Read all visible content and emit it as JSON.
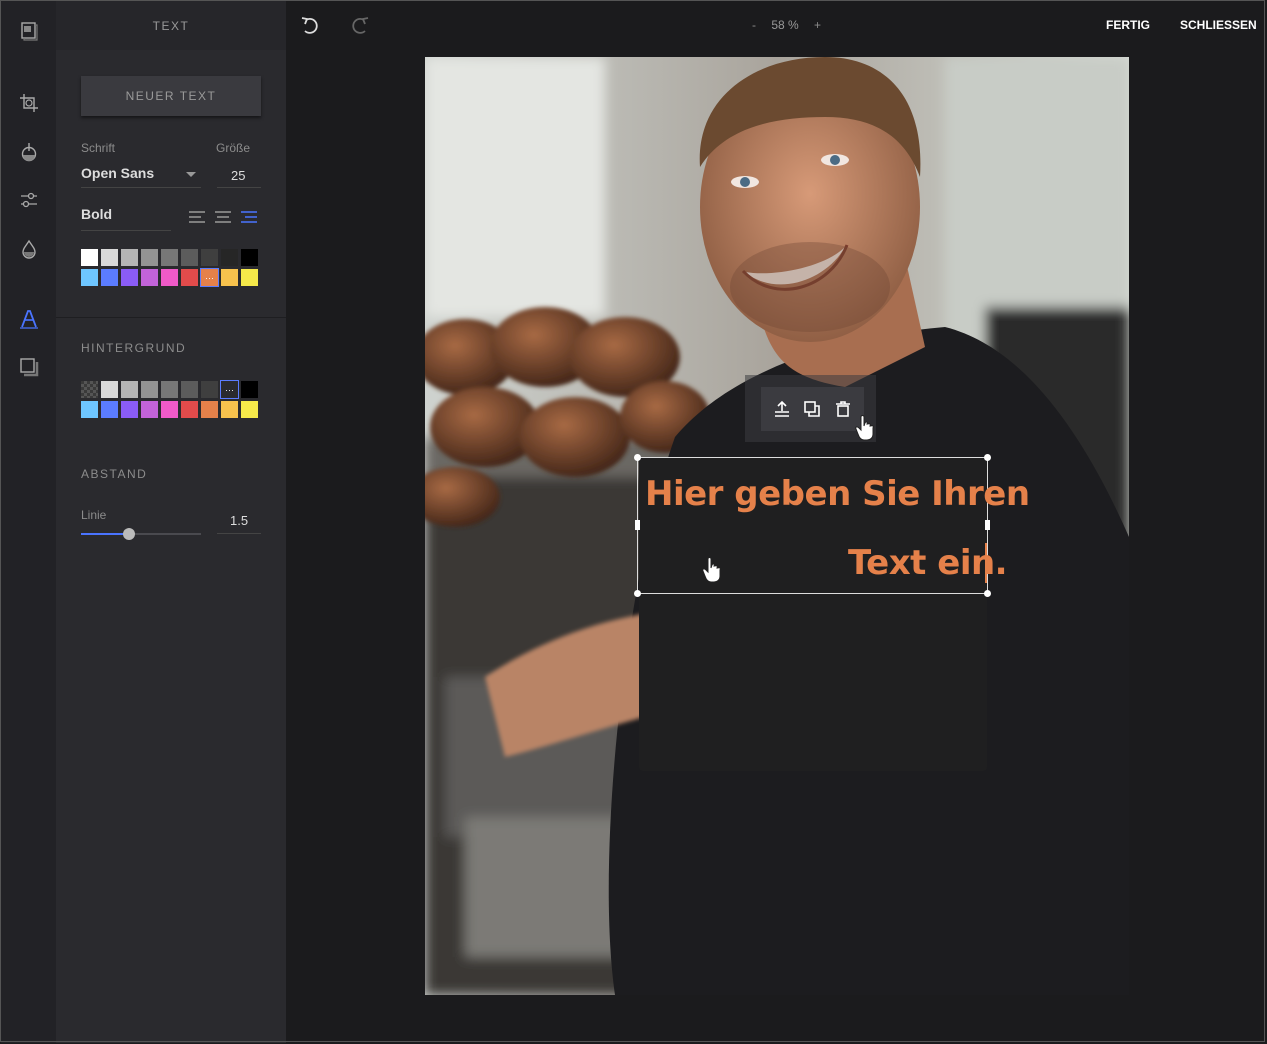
{
  "panel": {
    "title": "TEXT",
    "new_text_label": "NEUER TEXT",
    "font_label": "Schrift",
    "font_value": "Open Sans",
    "size_label": "Größe",
    "size_value": "25",
    "style_value": "Bold",
    "text_colors": [
      "#ffffff",
      "#d9d9d9",
      "#b5b5b5",
      "#939393",
      "#777777",
      "#5c5c5c",
      "#3f3f3f",
      "#262626",
      "#000000",
      "#6ec6ff",
      "#5b7cff",
      "#8a5cf6",
      "#c263d9",
      "#f05ac8",
      "#e24b4b",
      "#e5814a",
      "#f7c24d",
      "#f5e94a"
    ],
    "text_color_selected": 15,
    "background_title": "HINTERGRUND",
    "bg_colors": [
      "transparent",
      "#d9d9d9",
      "#b5b5b5",
      "#939393",
      "#777777",
      "#5c5c5c",
      "#3f3f3f",
      "#262626",
      "#000000",
      "#6ec6ff",
      "#5b7cff",
      "#8a5cf6",
      "#c263d9",
      "#f05ac8",
      "#e24b4b",
      "#e5814a",
      "#f7c24d",
      "#f5e94a"
    ],
    "bg_color_selected": 7,
    "spacing_title": "ABSTAND",
    "line_label": "Linie",
    "line_value": "1.5",
    "line_slider_fraction": 0.4
  },
  "topbar": {
    "zoom_minus": "-",
    "zoom_value": "58 %",
    "zoom_plus": "+",
    "done_label": "FERTIG",
    "close_label": "SCHLIESSEN"
  },
  "canvas": {
    "text_line1": "Hier geben Sie Ihren",
    "text_line2": "Text ein.",
    "text_color": "#e5814a"
  },
  "icons": {
    "rail": [
      "frame-icon",
      "crop-icon",
      "filter-icon",
      "adjust-icon",
      "droplet-icon",
      "text-icon",
      "border-icon"
    ],
    "toolbar": [
      "bring-front-icon",
      "duplicate-icon",
      "delete-icon"
    ]
  }
}
